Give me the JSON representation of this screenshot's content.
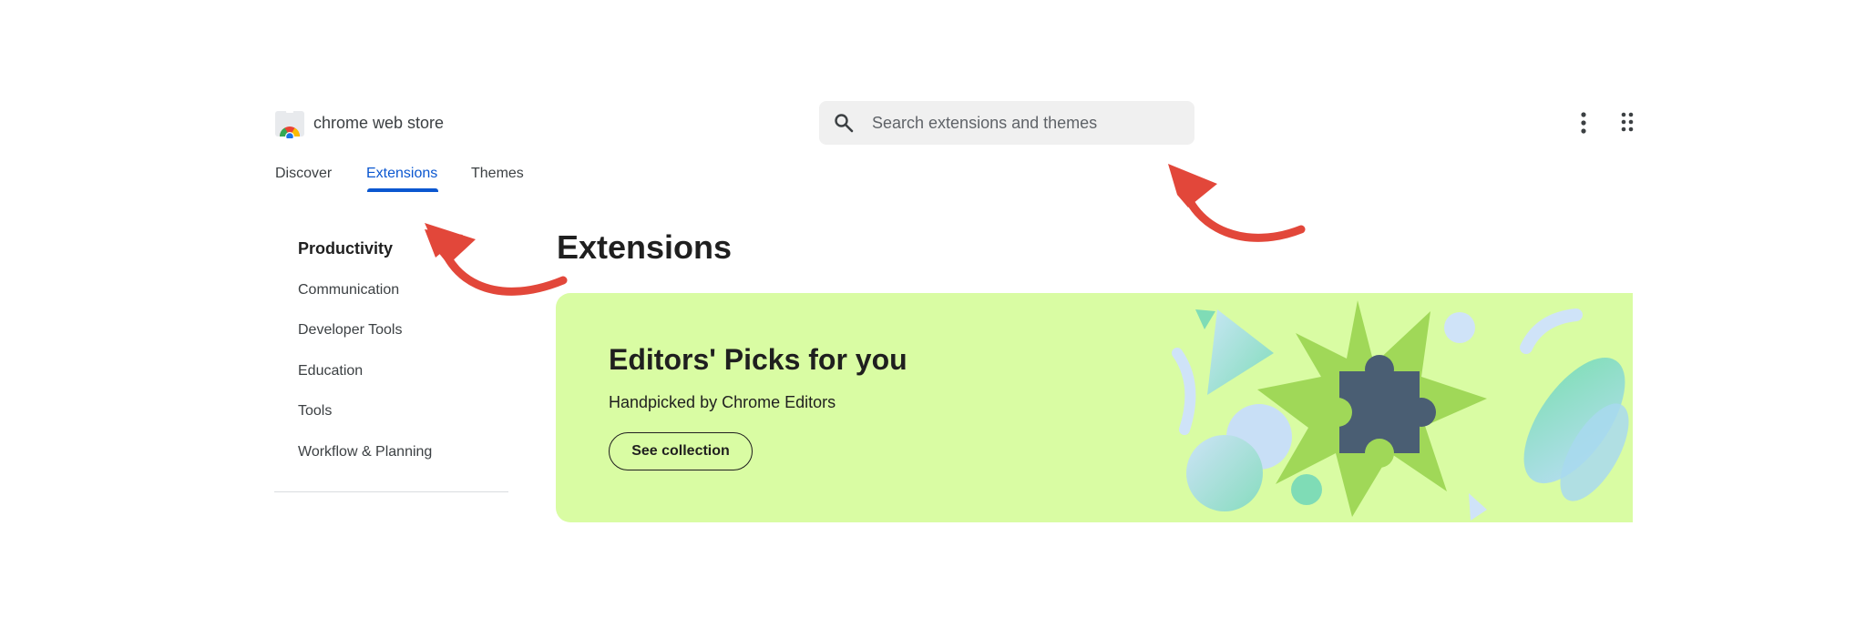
{
  "header": {
    "brand": "chrome web store",
    "search_placeholder": "Search extensions and themes"
  },
  "tabs": [
    {
      "label": "Discover",
      "active": false
    },
    {
      "label": "Extensions",
      "active": true
    },
    {
      "label": "Themes",
      "active": false
    }
  ],
  "sidebar": {
    "items": [
      {
        "label": "Productivity",
        "active": true
      },
      {
        "label": "Communication",
        "active": false
      },
      {
        "label": "Developer Tools",
        "active": false
      },
      {
        "label": "Education",
        "active": false
      },
      {
        "label": "Tools",
        "active": false
      },
      {
        "label": "Workflow & Planning",
        "active": false
      }
    ]
  },
  "main": {
    "title": "Extensions",
    "banner": {
      "title": "Editors' Picks for you",
      "subtitle": "Handpicked by Chrome Editors",
      "button_label": "See collection"
    }
  },
  "icons": {
    "logo": "chrome-web-store-logo",
    "search": "search-icon",
    "more": "more-vert-icon",
    "apps": "apps-grid-icon"
  },
  "colors": {
    "accent": "#0b57d0",
    "banner_bg": "#d9fca3",
    "annotation_arrow": "#e2473a",
    "puzzle": "#4a5e73"
  }
}
